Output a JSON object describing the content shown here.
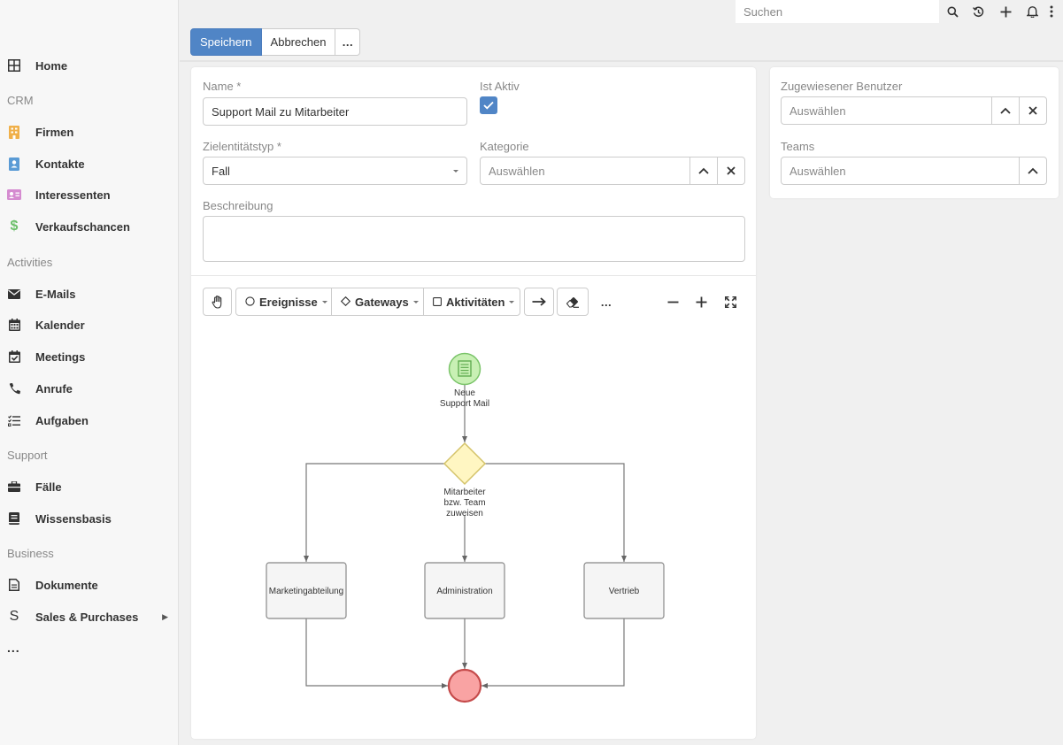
{
  "sidebar": {
    "items": [
      {
        "label": "Home",
        "icon": "grid-icon"
      },
      {
        "label": "Firmen",
        "icon": "building-icon",
        "color": "#f0b04a"
      },
      {
        "label": "Kontakte",
        "icon": "contact-card-icon",
        "color": "#5a9bd5"
      },
      {
        "label": "Interessenten",
        "icon": "id-card-icon",
        "color": "#d58bd0"
      },
      {
        "label": "Verkaufschancen",
        "icon": "dollar-icon",
        "color": "#6abf69"
      },
      {
        "label": "E-Mails",
        "icon": "envelope-icon"
      },
      {
        "label": "Kalender",
        "icon": "calendar-icon"
      },
      {
        "label": "Meetings",
        "icon": "calendar-check-icon"
      },
      {
        "label": "Anrufe",
        "icon": "phone-icon"
      },
      {
        "label": "Aufgaben",
        "icon": "task-list-icon"
      },
      {
        "label": "Fälle",
        "icon": "briefcase-icon"
      },
      {
        "label": "Wissensbasis",
        "icon": "book-icon"
      },
      {
        "label": "Dokumente",
        "icon": "document-icon"
      },
      {
        "label": "Sales & Purchases",
        "icon": "s-letter-icon"
      }
    ],
    "groups": [
      "CRM",
      "Activities",
      "Support",
      "Business"
    ],
    "more": "..."
  },
  "topbar": {
    "search_placeholder": "Suchen"
  },
  "toolbar": {
    "save": "Speichern",
    "cancel": "Abbrechen",
    "more": "..."
  },
  "form": {
    "name_label": "Name *",
    "name_value": "Support Mail zu Mitarbeiter",
    "active_label": "Ist Aktiv",
    "active_checked": true,
    "target_label": "Zielentitätstyp *",
    "target_value": "Fall",
    "category_label": "Kategorie",
    "category_placeholder": "Auswählen",
    "description_label": "Beschreibung"
  },
  "side": {
    "assigned_label": "Zugewiesener Benutzer",
    "assigned_placeholder": "Auswählen",
    "teams_label": "Teams",
    "teams_placeholder": "Auswählen"
  },
  "flow_toolbar": {
    "events": "Ereignisse",
    "gateways": "Gateways",
    "activities": "Aktivitäten",
    "more": "..."
  },
  "diagram": {
    "start_label_1": "Neue",
    "start_label_2": "Support Mail",
    "gateway_label_1": "Mitarbeiter",
    "gateway_label_2": "bzw. Team",
    "gateway_label_3": "zuweisen",
    "task_1": "Marketingabteilung",
    "task_2": "Administration",
    "task_3": "Vertrieb"
  },
  "colors": {
    "primary": "#5085c6",
    "start_event_fill": "#c8f0b4",
    "start_event_stroke": "#7bc46a",
    "gateway_fill": "#fff6c2",
    "gateway_stroke": "#d4c36a",
    "end_event_fill": "#f9a3a3",
    "end_event_stroke": "#c54b4b"
  }
}
